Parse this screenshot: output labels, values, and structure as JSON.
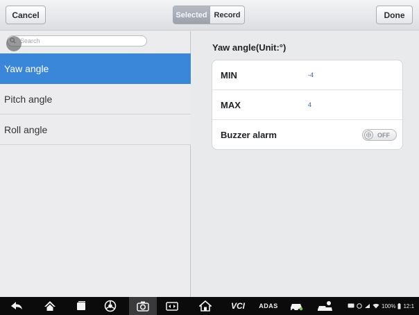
{
  "toolbar": {
    "cancel_label": "Cancel",
    "segments": [
      {
        "label": "Selected",
        "selected": true
      },
      {
        "label": "Record",
        "selected": false
      }
    ],
    "done_label": "Done"
  },
  "search": {
    "placeholder": "Search"
  },
  "list": {
    "items": [
      {
        "label": "Yaw angle",
        "active": true
      },
      {
        "label": "Pitch angle",
        "active": false
      },
      {
        "label": "Roll angle",
        "active": false
      }
    ]
  },
  "detail": {
    "title": "Yaw angle(Unit:°)",
    "min_label": "MIN",
    "min_value": "-4",
    "max_label": "MAX",
    "max_value": "4",
    "buzzer_label": "Buzzer alarm",
    "buzzer_state": "OFF"
  },
  "navbar": {
    "icons": [
      "back-icon",
      "home-icon",
      "recent-apps-icon",
      "browser-icon",
      "camera-icon",
      "screen-switch-icon",
      "vehicle-home-icon",
      "vci-icon",
      "adas-icon",
      "car-icon",
      "remote-expert-icon"
    ],
    "vci_label": "VCI",
    "adas_label": "ADAS",
    "battery_text": "100%",
    "clock_text": "12:1"
  },
  "colors": {
    "accent": "#3a86d8",
    "value_text": "#3b5fa8"
  }
}
